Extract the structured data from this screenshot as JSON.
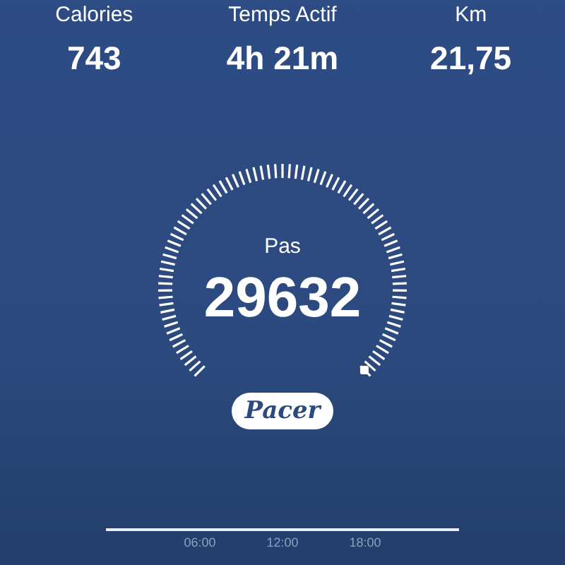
{
  "stats": [
    {
      "label": "Calories",
      "value": "743"
    },
    {
      "label": "Temps Actif",
      "value": "4h 21m"
    },
    {
      "label": "Km",
      "value": "21,75"
    }
  ],
  "gauge": {
    "label": "Pas",
    "value": "29632"
  },
  "brand_button": "Pacer",
  "timeline": {
    "ticks": [
      "06:00",
      "12:00",
      "18:00"
    ]
  }
}
